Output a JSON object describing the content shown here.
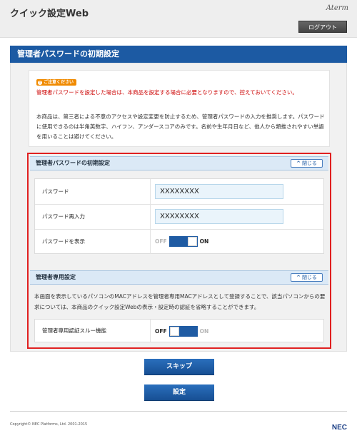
{
  "header": {
    "app_title": "クイック設定Web",
    "brand": "Aterm",
    "logout_label": "ログアウト"
  },
  "page": {
    "title": "管理者パスワードの初期設定"
  },
  "notice": {
    "caution_badge": "ご注意ください",
    "caution_text": "管理者パスワードを設定した場合は、本商品を設定する場合に必要となりますので、控えておいてください。",
    "info_text": "本商品は、第三者による不意のアクセスや設定変更を防止するため、管理者パスワードの入力を推奨します。パスワードに使用できるのは半角英数字、ハイフン、アンダースコアのみです。名前や生年月日など、他人から類推されやすい単語を用いることは避けてください。"
  },
  "password_section": {
    "title": "管理者パスワードの初期設定",
    "close_label": "閉じる",
    "rows": [
      {
        "label": "パスワード",
        "value": "XXXXXXXX"
      },
      {
        "label": "パスワード再入力",
        "value": "XXXXXXXX"
      },
      {
        "label": "パスワードを表示"
      }
    ],
    "show_toggle": {
      "off_label": "OFF",
      "on_label": "ON",
      "state": "on"
    }
  },
  "admin_section": {
    "title": "管理者専用設定",
    "close_label": "閉じる",
    "description": "本画面を表示しているパソコンのMACアドレスを管理者専用MACアドレスとして登録することで、該当パソコンからの要求については、本商品のクイック設定Webの表示・設定時の認証を省略することができます。",
    "bypass_label": "管理者専用認証スルー機能",
    "bypass_toggle": {
      "off_label": "OFF",
      "on_label": "ON",
      "state": "off"
    }
  },
  "actions": {
    "skip_label": "スキップ",
    "set_label": "設定"
  },
  "footer": {
    "copyright": "Copyright© NEC Platforms, Ltd. 2001-2015",
    "logo": "NEC"
  },
  "colors": {
    "primary": "#1c5aa3",
    "caution": "#cc0000",
    "badge": "#f08a00",
    "highlight_frame": "#e02020"
  }
}
